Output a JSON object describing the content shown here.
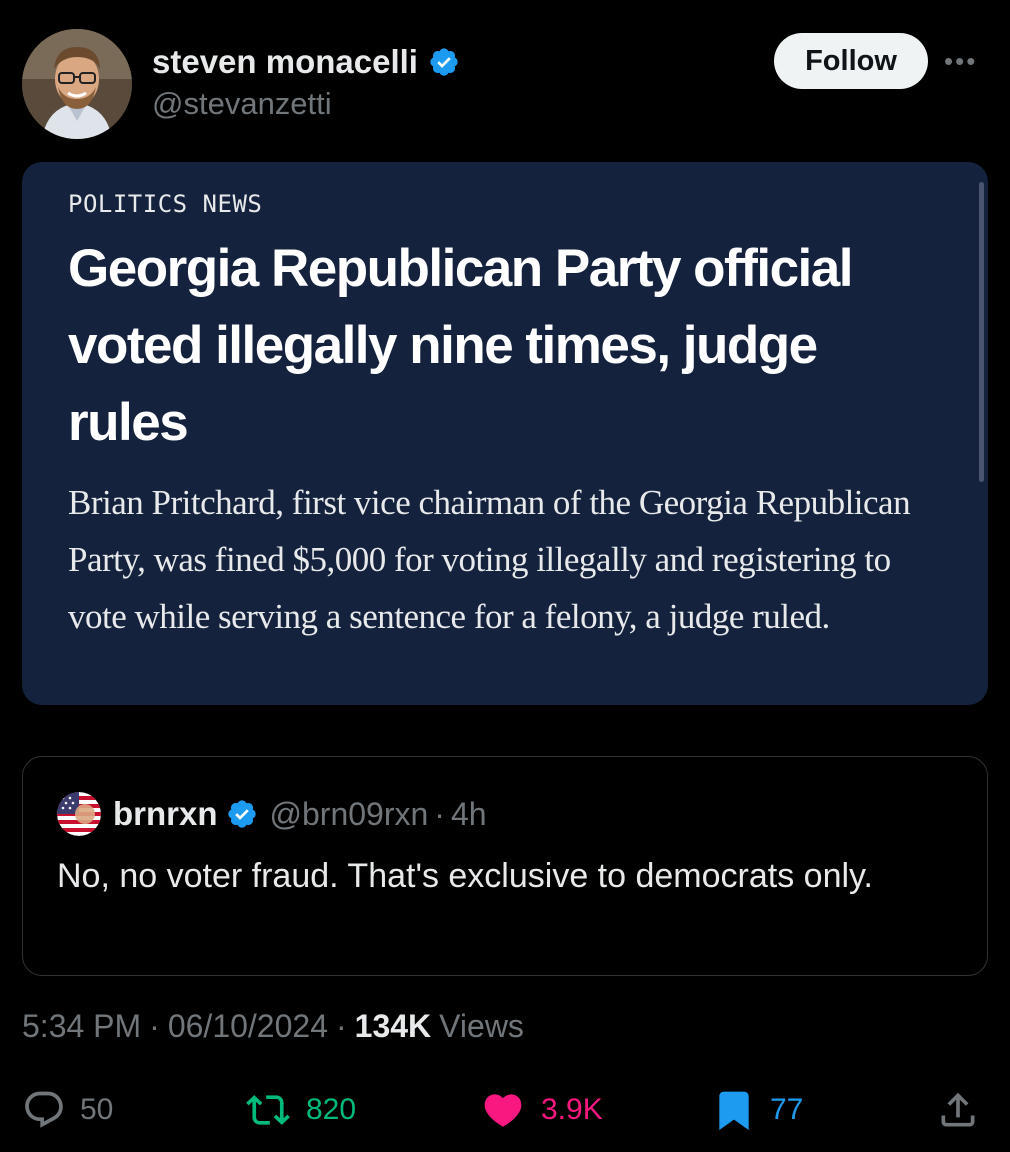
{
  "author": {
    "display_name": "steven monacelli",
    "handle": "@stevanzetti",
    "follow_label": "Follow"
  },
  "link_card": {
    "kicker": "POLITICS NEWS",
    "headline": "Georgia Republican Party official voted illegally nine times, judge rules",
    "summary": "Brian Pritchard, first vice chairman of the Georgia Republican Party, was fined $5,000 for voting illegally and registering to vote while serving a sentence for a felony, a judge ruled."
  },
  "quoted_post": {
    "display_name": "brnrxn",
    "handle": "@brn09rxn",
    "separator": "·",
    "time": "4h",
    "text": "No, no voter fraud. That's exclusive to democrats only."
  },
  "meta": {
    "time": "5:34 PM",
    "date": "06/10/2024",
    "separator": "·",
    "views_count": "134K",
    "views_label": "Views"
  },
  "actions": {
    "replies": "50",
    "reposts": "820",
    "likes": "3.9K",
    "bookmarks": "77"
  },
  "colors": {
    "background": "#000000",
    "card_bg": "#14223d",
    "verified": "#1d9bf0",
    "repost": "#00ba7c",
    "like": "#f91880",
    "bookmark": "#1d9bf0",
    "muted": "#71767b"
  },
  "icons": [
    "verified-badge-icon",
    "more-icon",
    "reply-icon",
    "retweet-icon",
    "heart-icon",
    "bookmark-icon",
    "share-icon"
  ]
}
